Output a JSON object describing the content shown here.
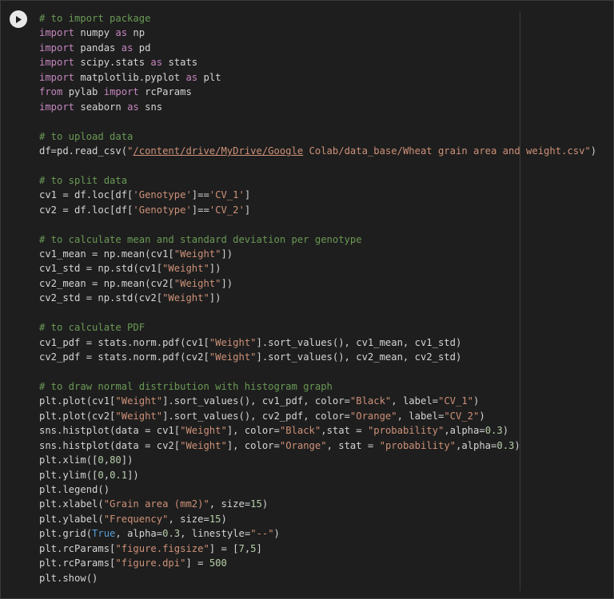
{
  "toolbar": {
    "run_icon": "play-icon"
  },
  "code": {
    "lines": [
      [
        {
          "t": "comment",
          "v": "# to import package"
        }
      ],
      [
        {
          "t": "keyword",
          "v": "import"
        },
        {
          "t": "plain",
          "v": " numpy "
        },
        {
          "t": "keyword",
          "v": "as"
        },
        {
          "t": "plain",
          "v": " np"
        }
      ],
      [
        {
          "t": "keyword",
          "v": "import"
        },
        {
          "t": "plain",
          "v": " pandas "
        },
        {
          "t": "keyword",
          "v": "as"
        },
        {
          "t": "plain",
          "v": " pd"
        }
      ],
      [
        {
          "t": "keyword",
          "v": "import"
        },
        {
          "t": "plain",
          "v": " scipy.stats "
        },
        {
          "t": "keyword",
          "v": "as"
        },
        {
          "t": "plain",
          "v": " stats"
        }
      ],
      [
        {
          "t": "keyword",
          "v": "import"
        },
        {
          "t": "plain",
          "v": " matplotlib.pyplot "
        },
        {
          "t": "keyword",
          "v": "as"
        },
        {
          "t": "plain",
          "v": " plt"
        }
      ],
      [
        {
          "t": "keyword",
          "v": "from"
        },
        {
          "t": "plain",
          "v": " pylab "
        },
        {
          "t": "keyword",
          "v": "import"
        },
        {
          "t": "plain",
          "v": " rcParams"
        }
      ],
      [
        {
          "t": "keyword",
          "v": "import"
        },
        {
          "t": "plain",
          "v": " seaborn "
        },
        {
          "t": "keyword",
          "v": "as"
        },
        {
          "t": "plain",
          "v": " sns"
        }
      ],
      [],
      [
        {
          "t": "comment",
          "v": "# to upload data"
        }
      ],
      [
        {
          "t": "plain",
          "v": "df=pd.read_csv("
        },
        {
          "t": "string",
          "v": "\""
        },
        {
          "t": "link",
          "v": "/content/drive/MyDrive/Google"
        },
        {
          "t": "string",
          "v": " Colab/data_base/Wheat grain area and weight.csv\""
        },
        {
          "t": "plain",
          "v": ")"
        }
      ],
      [],
      [
        {
          "t": "comment",
          "v": "# to split data"
        }
      ],
      [
        {
          "t": "plain",
          "v": "cv1 = df.loc[df["
        },
        {
          "t": "string",
          "v": "'Genotype'"
        },
        {
          "t": "plain",
          "v": "]=="
        },
        {
          "t": "string",
          "v": "'CV_1'"
        },
        {
          "t": "plain",
          "v": "]"
        }
      ],
      [
        {
          "t": "plain",
          "v": "cv2 = df.loc[df["
        },
        {
          "t": "string",
          "v": "'Genotype'"
        },
        {
          "t": "plain",
          "v": "]=="
        },
        {
          "t": "string",
          "v": "'CV_2'"
        },
        {
          "t": "plain",
          "v": "]"
        }
      ],
      [],
      [
        {
          "t": "comment",
          "v": "# to calculate mean and standard deviation per genotype"
        }
      ],
      [
        {
          "t": "plain",
          "v": "cv1_mean = np.mean(cv1["
        },
        {
          "t": "string",
          "v": "\"Weight\""
        },
        {
          "t": "plain",
          "v": "])"
        }
      ],
      [
        {
          "t": "plain",
          "v": "cv1_std = np.std(cv1["
        },
        {
          "t": "string",
          "v": "\"Weight\""
        },
        {
          "t": "plain",
          "v": "])"
        }
      ],
      [
        {
          "t": "plain",
          "v": "cv2_mean = np.mean(cv2["
        },
        {
          "t": "string",
          "v": "\"Weight\""
        },
        {
          "t": "plain",
          "v": "])"
        }
      ],
      [
        {
          "t": "plain",
          "v": "cv2_std = np.std(cv2["
        },
        {
          "t": "string",
          "v": "\"Weight\""
        },
        {
          "t": "plain",
          "v": "])"
        }
      ],
      [],
      [
        {
          "t": "comment",
          "v": "# to calculate PDF"
        }
      ],
      [
        {
          "t": "plain",
          "v": "cv1_pdf = stats.norm.pdf(cv1["
        },
        {
          "t": "string",
          "v": "\"Weight\""
        },
        {
          "t": "plain",
          "v": "].sort_values(), cv1_mean, cv1_std)"
        }
      ],
      [
        {
          "t": "plain",
          "v": "cv2_pdf = stats.norm.pdf(cv2["
        },
        {
          "t": "string",
          "v": "\"Weight\""
        },
        {
          "t": "plain",
          "v": "].sort_values(), cv2_mean, cv2_std)"
        }
      ],
      [],
      [
        {
          "t": "comment",
          "v": "# to draw normal distribution with histogram graph"
        }
      ],
      [
        {
          "t": "plain",
          "v": "plt.plot(cv1["
        },
        {
          "t": "string",
          "v": "\"Weight\""
        },
        {
          "t": "plain",
          "v": "].sort_values(), cv1_pdf, color="
        },
        {
          "t": "string",
          "v": "\"Black\""
        },
        {
          "t": "plain",
          "v": ", label="
        },
        {
          "t": "string",
          "v": "\"CV_1\""
        },
        {
          "t": "plain",
          "v": ")"
        }
      ],
      [
        {
          "t": "plain",
          "v": "plt.plot(cv2["
        },
        {
          "t": "string",
          "v": "\"Weight\""
        },
        {
          "t": "plain",
          "v": "].sort_values(), cv2_pdf, color="
        },
        {
          "t": "string",
          "v": "\"Orange\""
        },
        {
          "t": "plain",
          "v": ", label="
        },
        {
          "t": "string",
          "v": "\"CV_2\""
        },
        {
          "t": "plain",
          "v": ")"
        }
      ],
      [
        {
          "t": "plain",
          "v": "sns.histplot(data = cv1["
        },
        {
          "t": "string",
          "v": "\"Weight\""
        },
        {
          "t": "plain",
          "v": "], color="
        },
        {
          "t": "string",
          "v": "\"Black\""
        },
        {
          "t": "plain",
          "v": ",stat = "
        },
        {
          "t": "string",
          "v": "\"probability\""
        },
        {
          "t": "plain",
          "v": ",alpha="
        },
        {
          "t": "number",
          "v": "0.3"
        },
        {
          "t": "plain",
          "v": ")"
        }
      ],
      [
        {
          "t": "plain",
          "v": "sns.histplot(data = cv2["
        },
        {
          "t": "string",
          "v": "\"Weight\""
        },
        {
          "t": "plain",
          "v": "], color="
        },
        {
          "t": "string",
          "v": "\"Orange\""
        },
        {
          "t": "plain",
          "v": ", stat = "
        },
        {
          "t": "string",
          "v": "\"probability\""
        },
        {
          "t": "plain",
          "v": ",alpha="
        },
        {
          "t": "number",
          "v": "0.3"
        },
        {
          "t": "plain",
          "v": ")"
        }
      ],
      [
        {
          "t": "plain",
          "v": "plt.xlim(["
        },
        {
          "t": "number",
          "v": "0"
        },
        {
          "t": "plain",
          "v": ","
        },
        {
          "t": "number",
          "v": "80"
        },
        {
          "t": "plain",
          "v": "])"
        }
      ],
      [
        {
          "t": "plain",
          "v": "plt.ylim(["
        },
        {
          "t": "number",
          "v": "0"
        },
        {
          "t": "plain",
          "v": ","
        },
        {
          "t": "number",
          "v": "0.1"
        },
        {
          "t": "plain",
          "v": "])"
        }
      ],
      [
        {
          "t": "plain",
          "v": "plt.legend()"
        }
      ],
      [
        {
          "t": "plain",
          "v": "plt.xlabel("
        },
        {
          "t": "string",
          "v": "\"Grain area (mm2)\""
        },
        {
          "t": "plain",
          "v": ", size="
        },
        {
          "t": "number",
          "v": "15"
        },
        {
          "t": "plain",
          "v": ")"
        }
      ],
      [
        {
          "t": "plain",
          "v": "plt.ylabel("
        },
        {
          "t": "string",
          "v": "\"Frequency\""
        },
        {
          "t": "plain",
          "v": ", size="
        },
        {
          "t": "number",
          "v": "15"
        },
        {
          "t": "plain",
          "v": ")"
        }
      ],
      [
        {
          "t": "plain",
          "v": "plt.grid("
        },
        {
          "t": "builtin",
          "v": "True"
        },
        {
          "t": "plain",
          "v": ", alpha="
        },
        {
          "t": "number",
          "v": "0.3"
        },
        {
          "t": "plain",
          "v": ", linestyle="
        },
        {
          "t": "string",
          "v": "\"--\""
        },
        {
          "t": "plain",
          "v": ")"
        }
      ],
      [
        {
          "t": "plain",
          "v": "plt.rcParams["
        },
        {
          "t": "string",
          "v": "\"figure.figsize\""
        },
        {
          "t": "plain",
          "v": "] = ["
        },
        {
          "t": "number",
          "v": "7"
        },
        {
          "t": "plain",
          "v": ","
        },
        {
          "t": "number",
          "v": "5"
        },
        {
          "t": "plain",
          "v": "]"
        }
      ],
      [
        {
          "t": "plain",
          "v": "plt.rcParams["
        },
        {
          "t": "string",
          "v": "\"figure.dpi\""
        },
        {
          "t": "plain",
          "v": "] = "
        },
        {
          "t": "number",
          "v": "500"
        }
      ],
      [
        {
          "t": "plain",
          "v": "plt.show()"
        }
      ]
    ]
  },
  "colors": {
    "background": "#1e1e1e",
    "comment": "#6a9955",
    "keyword": "#c586c0",
    "string": "#ce9178",
    "number": "#b5cea8",
    "builtin": "#569cd6",
    "plain": "#d4d4d4"
  }
}
